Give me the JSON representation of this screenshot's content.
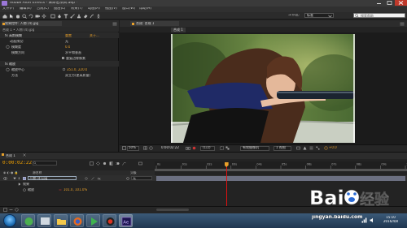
{
  "window": {
    "title": "Adobe After Effects - 未命名项目.aep *"
  },
  "menubar": {
    "items": [
      "文件(F)",
      "编辑(E)",
      "合成(C)",
      "图层(L)",
      "效果(T)",
      "动画(A)",
      "视图(V)",
      "窗口(W)",
      "帮助(H)"
    ]
  },
  "toolbar": {
    "workspace_label": "工作区:",
    "workspace_value": "标准",
    "search_placeholder": "搜索帮助"
  },
  "effect_controls": {
    "tab_label": "效果控件: 人物 (4).jpg",
    "header": "合成 1 • 人物 (4).jpg",
    "effect_name": "fx 高斯模糊",
    "reset": "重置",
    "about": "关于...",
    "rows": [
      {
        "name": "模糊度",
        "value": "0.0"
      },
      {
        "name": "模糊方向",
        "value": "水平和垂直"
      },
      {
        "name": "",
        "value": "重复边缘像素"
      }
    ],
    "anim_label": "动画预设:",
    "anim_value": "无",
    "fx2_name": "fx 缩放",
    "point_label": "缩放中心",
    "point_value": "351.0, 220.0",
    "method_label": "方法",
    "method_value": "双立方(更高质量)"
  },
  "composition": {
    "tab_label": "合成: 合成 1",
    "subtab_label": "合成 1"
  },
  "viewer_bar": {
    "zoom": "50%",
    "timecode": "0:00:02:22",
    "resolution": "(1/2)",
    "camera": "有效摄像机",
    "views": "1 视图",
    "exposure": "+0.0"
  },
  "timeline": {
    "tab_label": "合成 1",
    "timecode": "0:00:02:22",
    "col_source": "源名称",
    "col_parent": "父级",
    "layer_number": "1",
    "layer_name": "人物 (4).jpg",
    "parent_value": "无",
    "effects_label": "效果",
    "scale_label": "缩放",
    "scale_value": "101.0, 101.0%",
    "ruler_marks": [
      "0s",
      "01s",
      "02s",
      "03s",
      "04s",
      "05s",
      "06s",
      "07s",
      "08s",
      "09s",
      "10s"
    ],
    "playhead_fraction": 0.28
  },
  "taskbar": {
    "time": "15:10",
    "date": "2016/4/8"
  },
  "watermark": {
    "brand": "Baidu经验",
    "url": "jingyan.baidu.com"
  },
  "colors": {
    "accent_orange": "#e8a02a",
    "playhead": "#dd1111",
    "layer_bar": "#6b6f80"
  }
}
